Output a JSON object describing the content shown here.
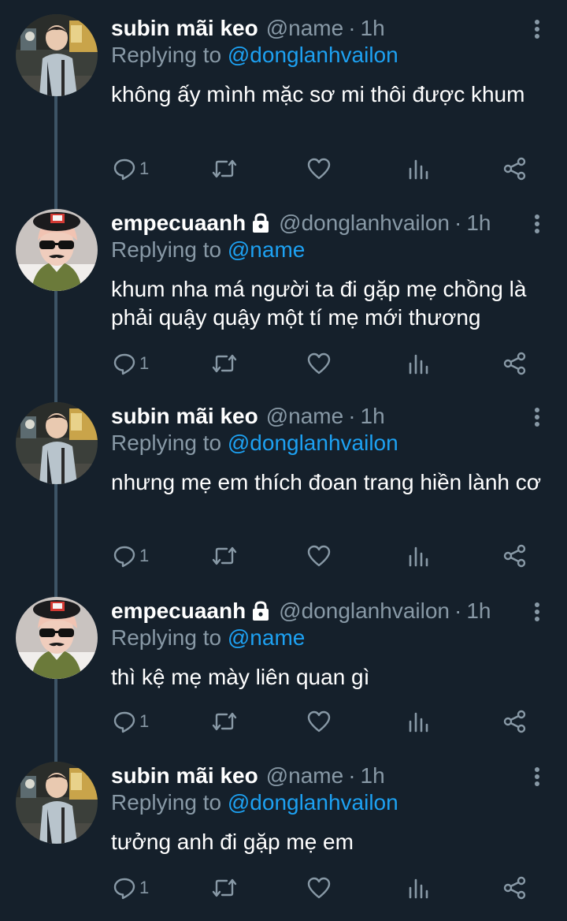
{
  "tweets": [
    {
      "name": "subin mãi keo",
      "handle": "@name",
      "time": "1h",
      "replying_prefix": "Replying to",
      "replying_to": "@donglanhvailon",
      "text": "không ấy mình mặc sơ mi thôi được khum",
      "reply_count": "1",
      "avatar": "street-night-photo",
      "locked": false
    },
    {
      "name": "empecuaanh",
      "handle": "@donglanhvailon",
      "time": "1h",
      "replying_prefix": "Replying to",
      "replying_to": "@name",
      "text": "khum nha má người ta đi gặp mẹ chồng là phải quậy quậy một tí mẹ mới thương",
      "reply_count": "1",
      "avatar": "sunglasses-beret-photo",
      "locked": true
    },
    {
      "name": "subin mãi keo",
      "handle": "@name",
      "time": "1h",
      "replying_prefix": "Replying to",
      "replying_to": "@donglanhvailon",
      "text": "nhưng mẹ em thích đoan trang hiền lành cơ",
      "reply_count": "1",
      "avatar": "street-night-photo",
      "locked": false
    },
    {
      "name": "empecuaanh",
      "handle": "@donglanhvailon",
      "time": "1h",
      "replying_prefix": "Replying to",
      "replying_to": "@name",
      "text": "thì kệ mẹ mày liên quan gì",
      "reply_count": "1",
      "avatar": "sunglasses-beret-photo",
      "locked": true
    },
    {
      "name": "subin mãi keo",
      "handle": "@name",
      "time": "1h",
      "replying_prefix": "Replying to",
      "replying_to": "@donglanhvailon",
      "text": "tưởng anh đi gặp mẹ em",
      "reply_count": "1",
      "avatar": "street-night-photo",
      "locked": false
    }
  ],
  "icons": {
    "reply": "reply-icon",
    "retweet": "retweet-icon",
    "like": "like-icon",
    "analytics": "analytics-icon",
    "share": "share-icon",
    "more": "more-vertical-icon",
    "lock": "lock-icon"
  },
  "colors": {
    "background": "#15202b",
    "primary_text": "#ffffff",
    "secondary_text": "#8899a6",
    "mention": "#1da1f2",
    "thread_line": "#3d5466"
  }
}
